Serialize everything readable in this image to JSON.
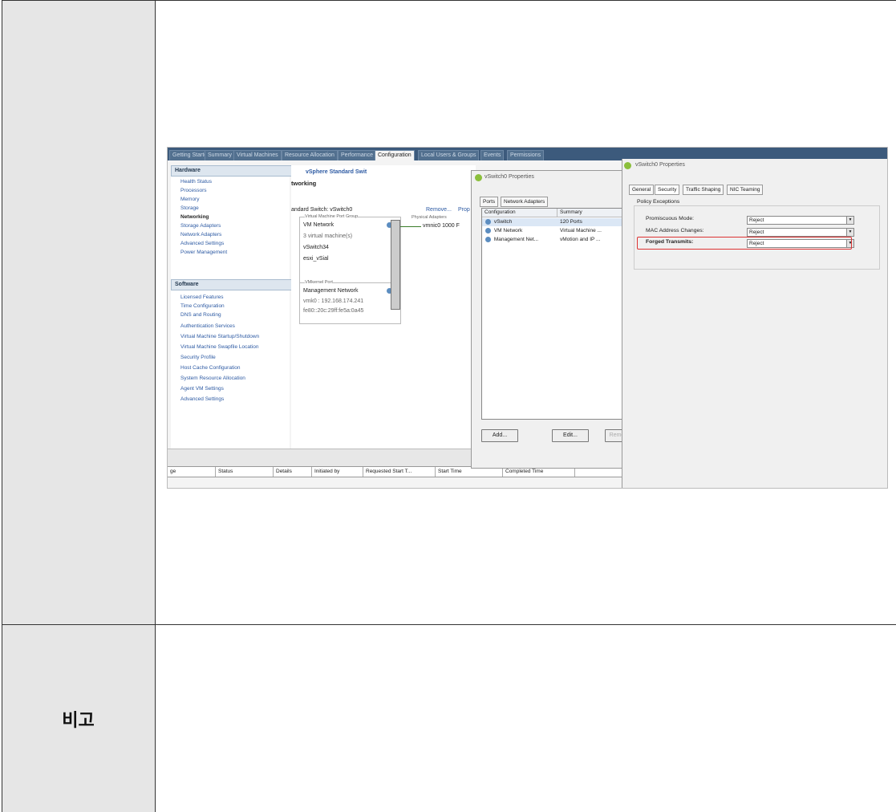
{
  "doc": {
    "remarks_label": "비고"
  },
  "screenshot": {
    "tabs": [
      "Getting Started",
      "Summary",
      "Virtual Machines",
      "Resource Allocation",
      "Performance",
      "Configuration",
      "Local Users & Groups",
      "Events",
      "Permissions"
    ],
    "active_tab": "Configuration",
    "hardware_header": "Hardware",
    "hardware_items": [
      "Health Status",
      "Processors",
      "Memory",
      "Storage",
      "Networking",
      "Storage Adapters",
      "Network Adapters",
      "Advanced Settings",
      "Power Management"
    ],
    "selected_hardware": "Networking",
    "software_header": "Software",
    "software_items": [
      "Licensed Features",
      "Time Configuration",
      "DNS and Routing",
      "Authentication Services",
      "Virtual Machine Startup/Shutdown",
      "Virtual Machine Swapfile Location",
      "Security Profile",
      "Host Cache Configuration",
      "System Resource Allocation",
      "Agent VM Settings",
      "Advanced Settings"
    ],
    "center": {
      "view_label": "vSphere Standard Swit",
      "networking_title": "tworking",
      "switch_label": "andard Switch: vSwitch0",
      "remove_link": "Remove...",
      "properties_link": "Prop",
      "vm_port_group_hdr": "Virtual Machine Port Group",
      "vm_network": "VM Network",
      "vm_count": "3 virtual machine(s)",
      "vm1": "vSwitch34",
      "vm2": "esxi_vSial",
      "vmkernel_hdr": "VMkernel Port",
      "mgmt_network": "Management Network",
      "mgmt_ip": "vmk0 : 192.168.174.241",
      "mgmt_ipv6": "fe80::20c:29ff:fe5a:0a45",
      "physical_hdr": "Physical Adapters",
      "nic": "vmnic0  1000  F"
    },
    "tasks_columns": [
      "ge",
      "Status",
      "Details",
      "Initiated by",
      "Requested Start T...",
      "Start Time",
      "Completed Time"
    ],
    "dialog1": {
      "title": "vSwitch0 Properties",
      "tabs": [
        "Ports",
        "Network Adapters"
      ],
      "col_config": "Configuration",
      "col_summary": "Summary",
      "rows": [
        {
          "name": "vSwitch",
          "summary": "120 Ports"
        },
        {
          "name": "VM Network",
          "summary": "Virtual Machine ..."
        },
        {
          "name": "Management Net...",
          "summary": "vMotion and IP ..."
        }
      ],
      "add_btn": "Add...",
      "edit_btn": "Edit...",
      "remove_btn": "Remo"
    },
    "dialog2": {
      "title": "vSwitch0 Properties",
      "tabs": [
        "General",
        "Security",
        "Traffic Shaping",
        "NIC Teaming"
      ],
      "group_label": "Policy Exceptions",
      "policies": [
        {
          "label": "Promiscuous Mode:",
          "value": "Reject"
        },
        {
          "label": "MAC Address Changes:",
          "value": "Reject"
        },
        {
          "label": "Forged Transmits:",
          "value": "Reject"
        }
      ]
    }
  }
}
